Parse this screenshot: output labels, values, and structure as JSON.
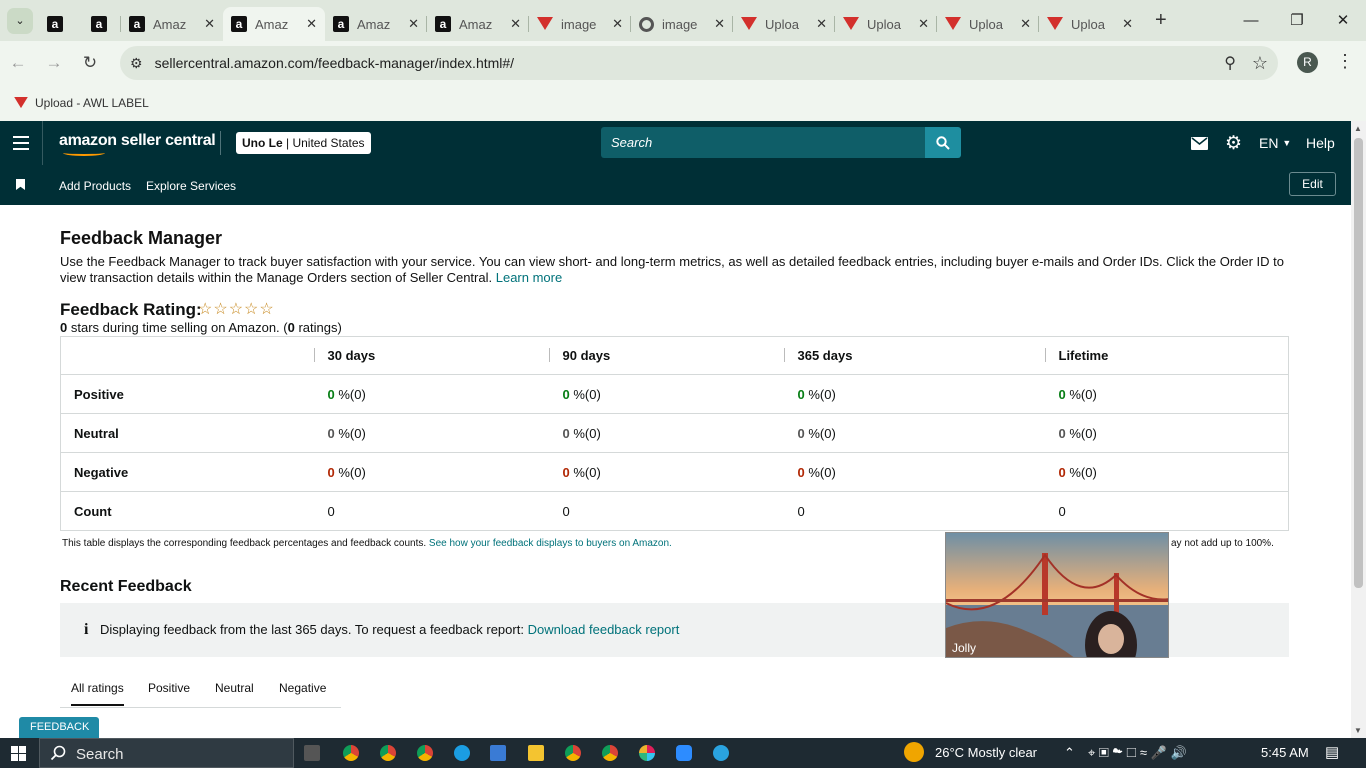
{
  "browser": {
    "tabs": [
      {
        "title": "",
        "favicon": "amazon-a-icon",
        "pinned": true
      },
      {
        "title": "",
        "favicon": "amazon-a-icon",
        "pinned": true
      },
      {
        "title": "Amaz",
        "favicon": "amazon-a-icon"
      },
      {
        "title": "Amaz",
        "favicon": "amazon-a-icon",
        "active": true
      },
      {
        "title": "Amaz",
        "favicon": "amazon-a-icon"
      },
      {
        "title": "Amaz",
        "favicon": "amazon-a-icon"
      },
      {
        "title": "image",
        "favicon": "red-triangle-icon"
      },
      {
        "title": "image",
        "favicon": "spiral-icon"
      },
      {
        "title": "Uploa",
        "favicon": "red-triangle-icon"
      },
      {
        "title": "Uploa",
        "favicon": "red-triangle-icon"
      },
      {
        "title": "Uploa",
        "favicon": "red-triangle-icon"
      },
      {
        "title": "Uploa",
        "favicon": "red-triangle-icon"
      }
    ],
    "url": "sellercentral.amazon.com/feedback-manager/index.html#/",
    "profile_initial": "R",
    "bookmark": "Upload - AWL LABEL"
  },
  "header": {
    "logo_text": "amazon seller central",
    "account_name": "Uno Le",
    "account_region": "| United States",
    "search_placeholder": "Search",
    "language": "EN",
    "help": "Help"
  },
  "subnav": {
    "links": [
      "Add Products",
      "Explore Services"
    ],
    "edit": "Edit"
  },
  "page": {
    "title": "Feedback Manager",
    "intro": "Use the Feedback Manager to track buyer satisfaction with your service. You can view short- and long-term metrics, as well as detailed feedback entries, including buyer e-mails and Order IDs. Click the Order ID to view transaction details within the Manage Orders section of Seller Central.",
    "learn_more": "Learn more",
    "rating_label": "Feedback Rating:",
    "stars_shown": 0,
    "stars_display": "☆☆☆☆☆",
    "stars_count": "0",
    "stars_text": " stars during time selling on Amazon. (",
    "ratings_count": "0",
    "ratings_text": " ratings)"
  },
  "table": {
    "columns": [
      "",
      "30 days",
      "90 days",
      "365 days",
      "Lifetime"
    ],
    "rows": [
      {
        "label": "Positive",
        "cells": [
          "0",
          "0",
          "0",
          "0"
        ],
        "suffix": " %(0)",
        "color": "#067d14"
      },
      {
        "label": "Neutral",
        "cells": [
          "0",
          "0",
          "0",
          "0"
        ],
        "suffix": " %(0)",
        "color": "#555555"
      },
      {
        "label": "Negative",
        "cells": [
          "0",
          "0",
          "0",
          "0"
        ],
        "suffix": " %(0)",
        "color": "#b12704"
      },
      {
        "label": "Count",
        "cells": [
          "0",
          "0",
          "0",
          "0"
        ],
        "suffix": ""
      }
    ],
    "note": "This table displays the corresponding feedback percentages and feedback counts.",
    "note_link": "See how your feedback displays to buyers on Amazon.",
    "note_right": "ay not add up to 100%."
  },
  "recent": {
    "title": "Recent Feedback",
    "info_text": "Displaying feedback from the last 365 days. To request a feedback report:",
    "info_link": "Download feedback report",
    "tabs": [
      "All ratings",
      "Positive",
      "Neutral",
      "Negative"
    ]
  },
  "video": {
    "participant": "Jolly"
  },
  "feedback_tag": "FEEDBACK",
  "taskbar": {
    "search": "Search",
    "weather": "26°C  Mostly clear",
    "time": "5:45 AM"
  },
  "colors": {
    "header_bg": "#002f36",
    "link": "#00727a",
    "positive": "#067d14",
    "negative": "#b12704"
  }
}
